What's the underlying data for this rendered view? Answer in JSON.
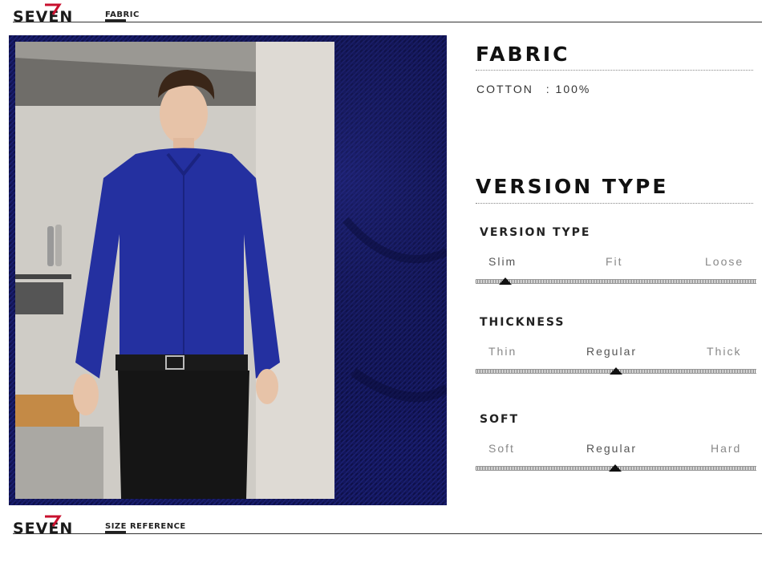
{
  "brand": {
    "name": "SEVEN"
  },
  "sections": {
    "fabric_tag": "FABRIC",
    "size_tag": "SIZE REFERENCE"
  },
  "fabric": {
    "heading": "FABRIC",
    "material": "COTTON",
    "separator": ":",
    "percentage": "100%"
  },
  "version": {
    "heading": "VERSION TYPE",
    "attributes": [
      {
        "title": "VERSION TYPE",
        "options": [
          "Slim",
          "Fit",
          "Loose"
        ],
        "selected": 0
      },
      {
        "title": "THICKNESS",
        "options": [
          "Thin",
          "Regular",
          "Thick"
        ],
        "selected": 1
      },
      {
        "title": "SOFT",
        "options": [
          "Soft",
          "Regular",
          "Hard"
        ],
        "selected": 1
      }
    ]
  },
  "colors": {
    "accent": "#c8102e",
    "panel": "#12155a",
    "shirt": "#2430a0"
  }
}
